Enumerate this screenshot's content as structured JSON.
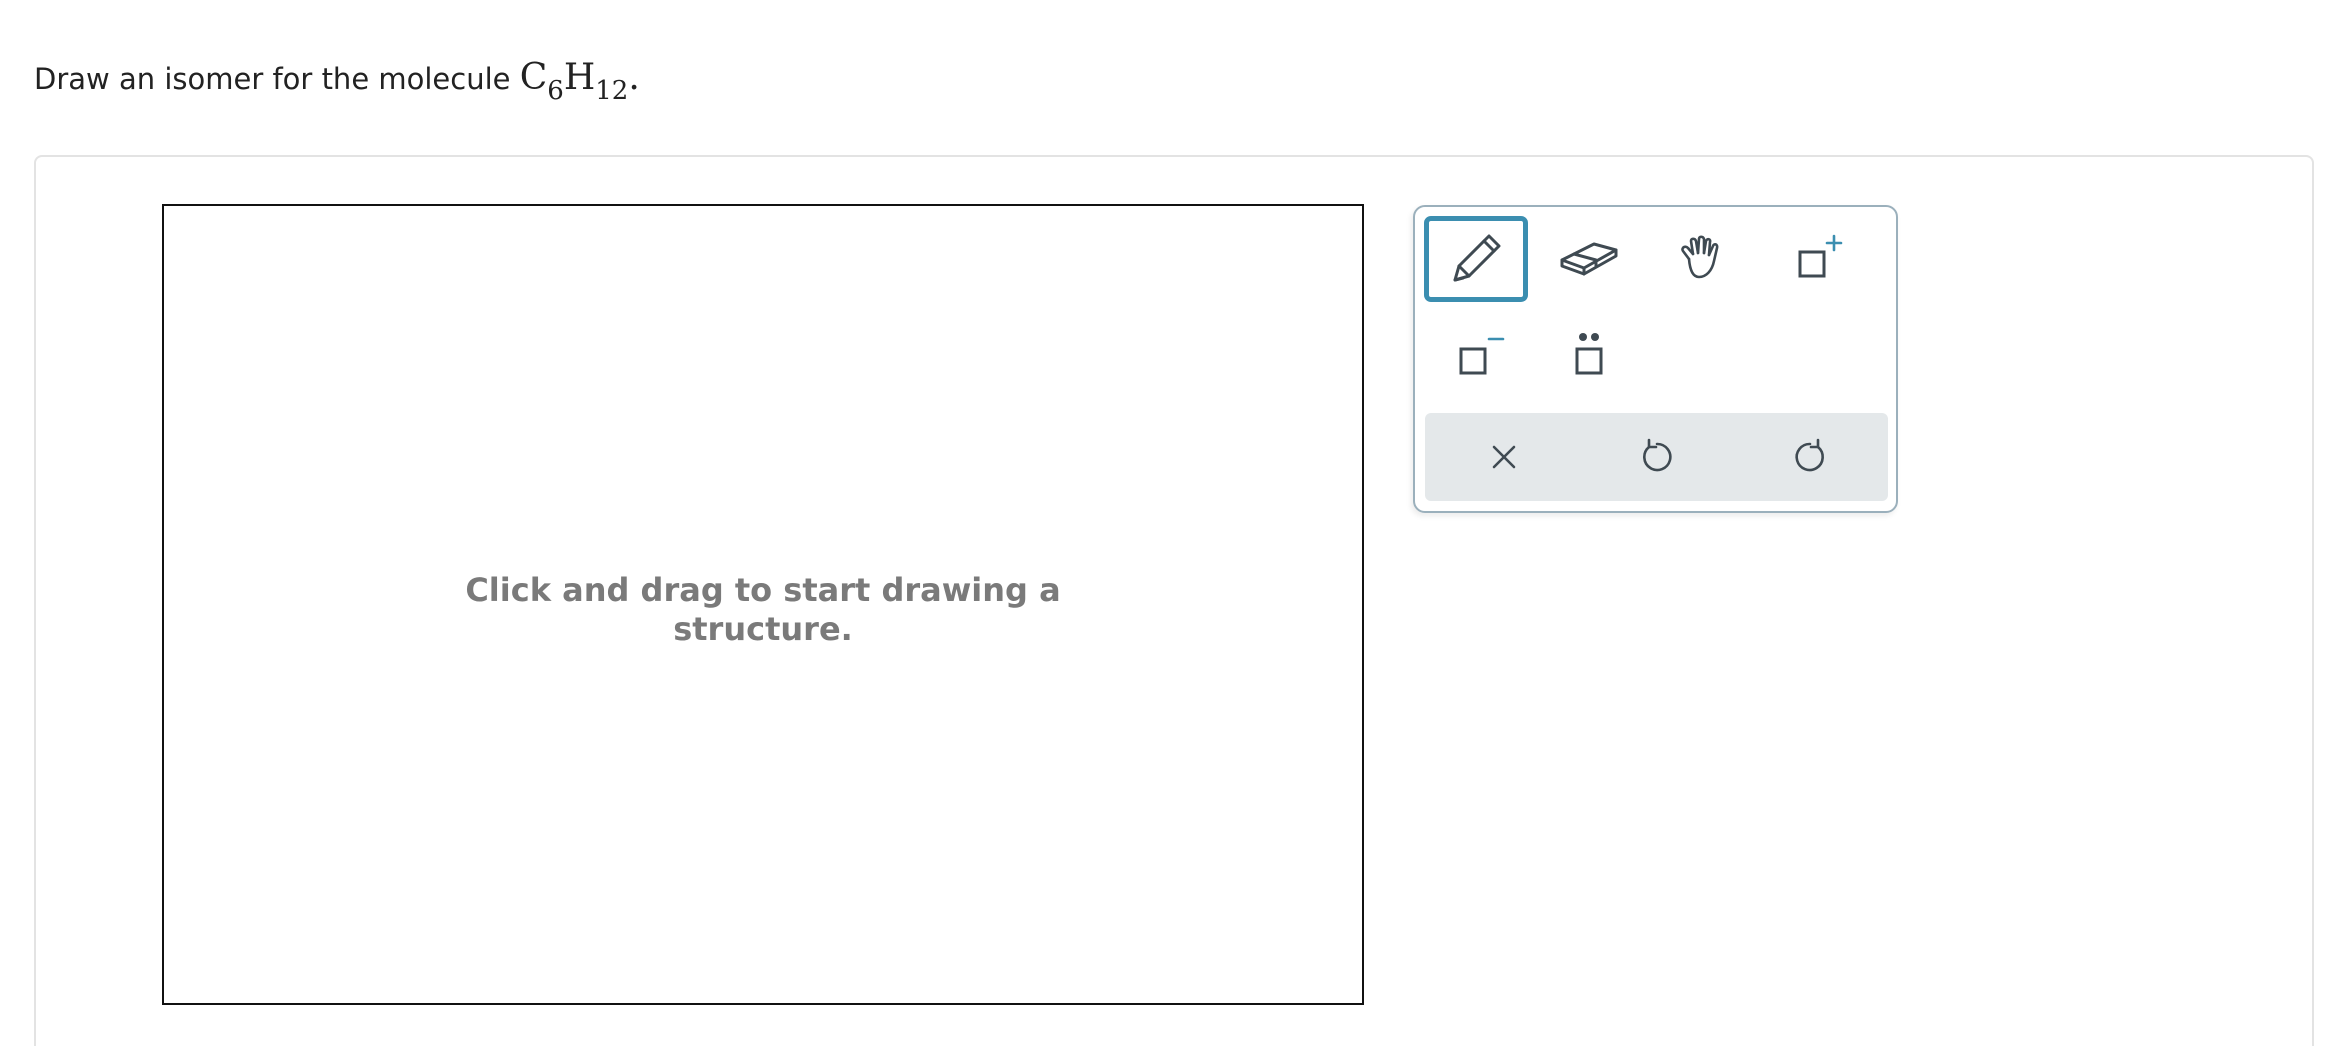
{
  "question": {
    "prefix": "Draw an isomer for the molecule ",
    "formula": {
      "c": "C",
      "c_count": "6",
      "h": "H",
      "h_count": "12",
      "suffix": "."
    }
  },
  "canvas": {
    "hint_line1": "Click and drag to start drawing a",
    "hint_line2": "structure."
  },
  "toolbar": {
    "selected_tool": "pencil",
    "tools": [
      "pencil-icon",
      "eraser-icon",
      "hand-move-icon",
      "positive-charge-icon",
      "negative-charge-icon",
      "lone-pair-icon"
    ],
    "actions": [
      "clear-icon",
      "undo-icon",
      "redo-icon"
    ]
  },
  "colors": {
    "accent": "#3b8eb0",
    "icon": "#3f4a52",
    "toolbar_border": "#9bb0bc",
    "action_bar": "#e4e8ea",
    "hint": "#7a7a7a"
  }
}
